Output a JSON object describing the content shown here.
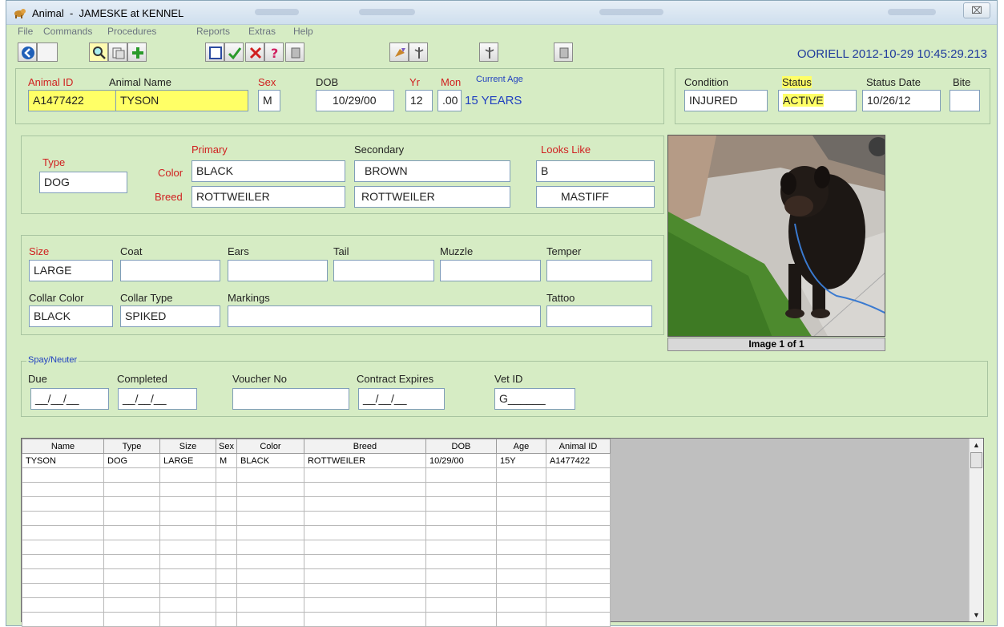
{
  "window": {
    "title": "Animal  -  JAMESKE at KENNEL",
    "close_glyph": "⌧"
  },
  "menu": [
    "File",
    "Commands",
    "Procedures",
    "Reports",
    "Extras",
    "Help"
  ],
  "toolbar": {
    "icons": [
      "back-icon",
      "search-icon",
      "copy-icon",
      "add-icon",
      "new-record-icon",
      "accept-icon",
      "delete-icon",
      "help-icon",
      "calculator-icon",
      "pet-icon",
      "vet-icon",
      "medical-icon",
      "notes-icon"
    ],
    "stamp": "OORIELL 2012-10-29 10:45:29.213"
  },
  "header": {
    "animal_id_label": "Animal ID",
    "animal_id": "A1477422",
    "animal_name_label": "Animal Name",
    "animal_name": "TYSON",
    "sex_label": "Sex",
    "sex": "M",
    "dob_label": "DOB",
    "dob": "10/29/00",
    "yr_label": "Yr",
    "yr": "12",
    "mon_label": "Mon",
    "mon": ".00",
    "current_age_label": "Current Age",
    "current_age": "15 YEARS"
  },
  "status_panel": {
    "condition_label": "Condition",
    "condition": "INJURED",
    "status_label": "Status",
    "status": "ACTIVE",
    "status_date_label": "Status Date",
    "status_date": "10/26/12",
    "bite_label": "Bite",
    "bite": ""
  },
  "description": {
    "type_label": "Type",
    "type": "DOG",
    "primary_label": "Primary",
    "secondary_label": "Secondary",
    "looks_like_label": "Looks Like",
    "color_label": "Color",
    "primary_color": "BLACK",
    "secondary_color": "BROWN",
    "looks_like_color": "B",
    "breed_label": "Breed",
    "primary_breed": "ROTTWEILER",
    "secondary_breed": "ROTTWEILER",
    "looks_like_breed": "MASTIFF"
  },
  "physical": {
    "size_label": "Size",
    "size": "LARGE",
    "coat_label": "Coat",
    "coat": "",
    "ears_label": "Ears",
    "ears": "",
    "tail_label": "Tail",
    "tail": "",
    "muzzle_label": "Muzzle",
    "muzzle": "",
    "temper_label": "Temper",
    "temper": "",
    "collar_color_label": "Collar Color",
    "collar_color": "BLACK",
    "collar_type_label": "Collar Type",
    "collar_type": "SPIKED",
    "markings_label": "Markings",
    "markings": "",
    "tattoo_label": "Tattoo",
    "tattoo": ""
  },
  "photo": {
    "caption": "Image 1 of 1"
  },
  "spay_neuter": {
    "legend": "Spay/Neuter",
    "due_label": "Due",
    "due": "__/__/__",
    "completed_label": "Completed",
    "completed": "__/__/__",
    "voucher_label": "Voucher No",
    "voucher": "",
    "contract_label": "Contract Expires",
    "contract": "__/__/__",
    "vet_id_label": "Vet ID",
    "vet_id": "G______"
  },
  "grid": {
    "columns": [
      "Name",
      "Type",
      "Size",
      "Sex",
      "Color",
      "Breed",
      "DOB",
      "Age",
      "Animal ID"
    ],
    "rows": [
      [
        "TYSON",
        "DOG",
        "LARGE",
        "M",
        "BLACK",
        "ROTTWEILER",
        "10/29/00",
        "15Y",
        "A1477422"
      ]
    ],
    "empty_rows": 11
  },
  "colors": {
    "panel_bg": "#d6ecc4",
    "highlight": "#ffff66",
    "label_red": "#d02020",
    "label_blue": "#2040c0"
  }
}
